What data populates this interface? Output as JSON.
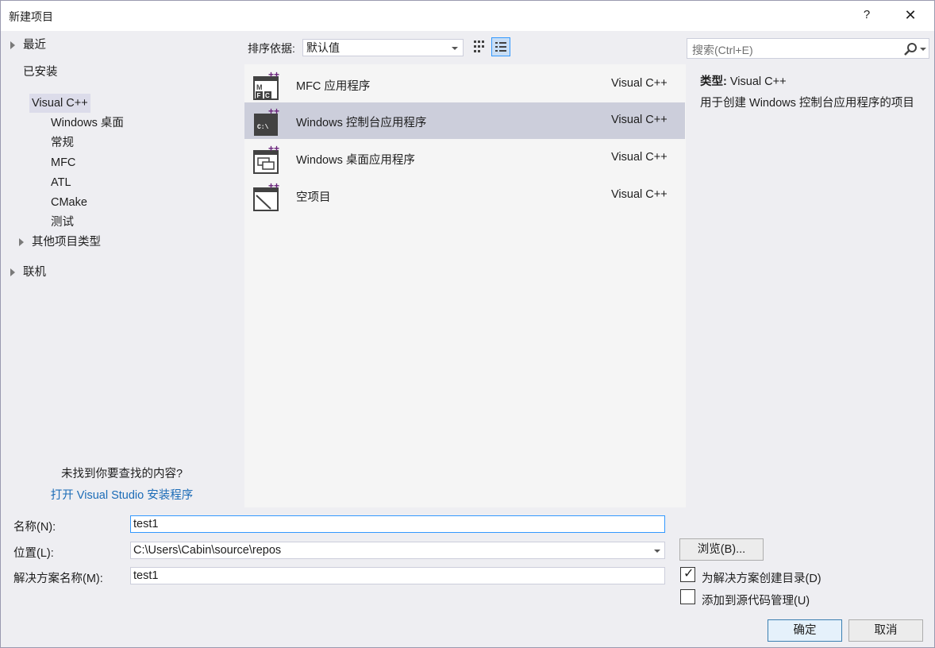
{
  "window": {
    "title": "新建项目",
    "help": "?",
    "close": "✕"
  },
  "tree": {
    "recent": "最近",
    "installed": "已安装",
    "visual_cpp": "Visual C++",
    "children": [
      "Windows 桌面",
      "常规",
      "MFC",
      "ATL",
      "CMake",
      "测试"
    ],
    "other_types": "其他项目类型",
    "online": "联机",
    "hint": "未找到你要查找的内容?",
    "installer_link": "打开 Visual Studio 安装程序"
  },
  "sort": {
    "label": "排序依据:",
    "value": "默认值"
  },
  "templates": [
    {
      "name": "MFC 应用程序",
      "lang": "Visual C++",
      "icon": "mfc-app-icon",
      "selected": false
    },
    {
      "name": "Windows 控制台应用程序",
      "lang": "Visual C++",
      "icon": "console-app-icon",
      "selected": true
    },
    {
      "name": "Windows 桌面应用程序",
      "lang": "Visual C++",
      "icon": "desktop-app-icon",
      "selected": false
    },
    {
      "name": "空项目",
      "lang": "Visual C++",
      "icon": "empty-project-icon",
      "selected": false
    }
  ],
  "search": {
    "placeholder": "搜索(Ctrl+E)"
  },
  "details": {
    "type_label": "类型:",
    "type_value": "Visual C++",
    "description": "用于创建 Windows 控制台应用程序的项目"
  },
  "form": {
    "name_label": "名称(N):",
    "name_value": "test1",
    "location_label": "位置(L):",
    "location_value": "C:\\Users\\Cabin\\source\\repos",
    "solution_label": "解决方案名称(M):",
    "solution_value": "test1",
    "browse": "浏览(B)...",
    "create_dir_label": "为解决方案创建目录(D)",
    "create_dir_checked": true,
    "source_control_label": "添加到源代码管理(U)",
    "source_control_checked": false
  },
  "buttons": {
    "ok": "确定",
    "cancel": "取消"
  },
  "colors": {
    "selection": "#cccedb",
    "link": "#1c6cb7",
    "accent": "#3399ff",
    "plus": "#68217a"
  }
}
